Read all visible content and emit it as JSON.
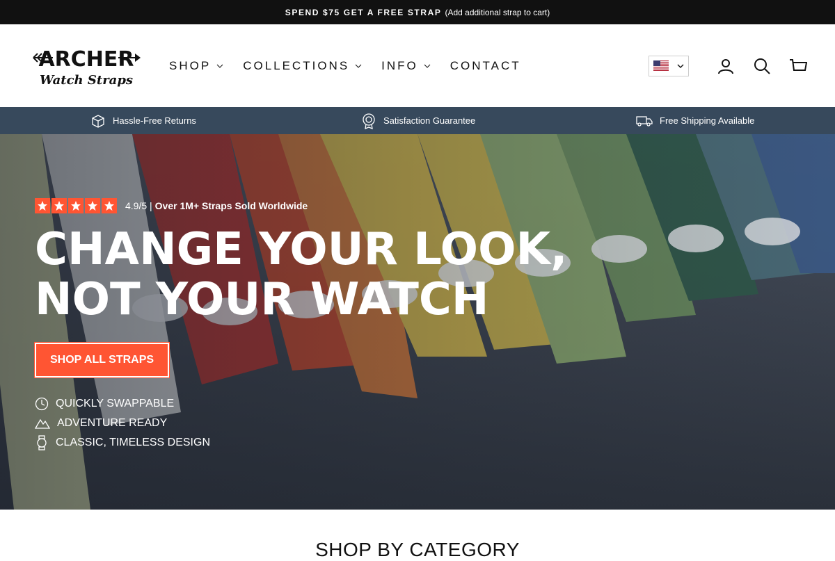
{
  "announcement": {
    "strong": "SPEND $75 GET A FREE STRAP",
    "sub": "(Add additional strap to cart)"
  },
  "brand": {
    "line1": "ARCHER",
    "line2": "Watch Straps"
  },
  "nav": [
    {
      "label": "SHOP",
      "has_dropdown": true
    },
    {
      "label": "COLLECTIONS",
      "has_dropdown": true
    },
    {
      "label": "INFO",
      "has_dropdown": true
    },
    {
      "label": "CONTACT",
      "has_dropdown": false
    }
  ],
  "header_icons": [
    "flag-us-icon",
    "user-icon",
    "search-icon",
    "cart-icon"
  ],
  "usp": [
    {
      "icon": "return-box-icon",
      "label": "Hassle-Free Returns"
    },
    {
      "icon": "award-ribbon-icon",
      "label": "Satisfaction Guarantee"
    },
    {
      "icon": "delivery-truck-icon",
      "label": "Free Shipping Available"
    }
  ],
  "hero": {
    "rating_score": "4.9/5 |",
    "rating_text": "Over 1M+ Straps Sold Worldwide",
    "stars": 5,
    "headline_line1": "CHANGE YOUR LOOK,",
    "headline_line2": "NOT YOUR WATCH",
    "cta": "SHOP ALL STRAPS",
    "features": [
      {
        "icon": "clock-icon",
        "label": "QUICKLY SWAPPABLE"
      },
      {
        "icon": "mountain-icon",
        "label": "ADVENTURE READY"
      },
      {
        "icon": "watch-icon",
        "label": "CLASSIC, TIMELESS DESIGN"
      }
    ]
  },
  "section": {
    "title": "SHOP BY CATEGORY"
  },
  "colors": {
    "accent": "#ff5533",
    "usp_bar": "#37495c",
    "announce_bar": "#111111"
  }
}
